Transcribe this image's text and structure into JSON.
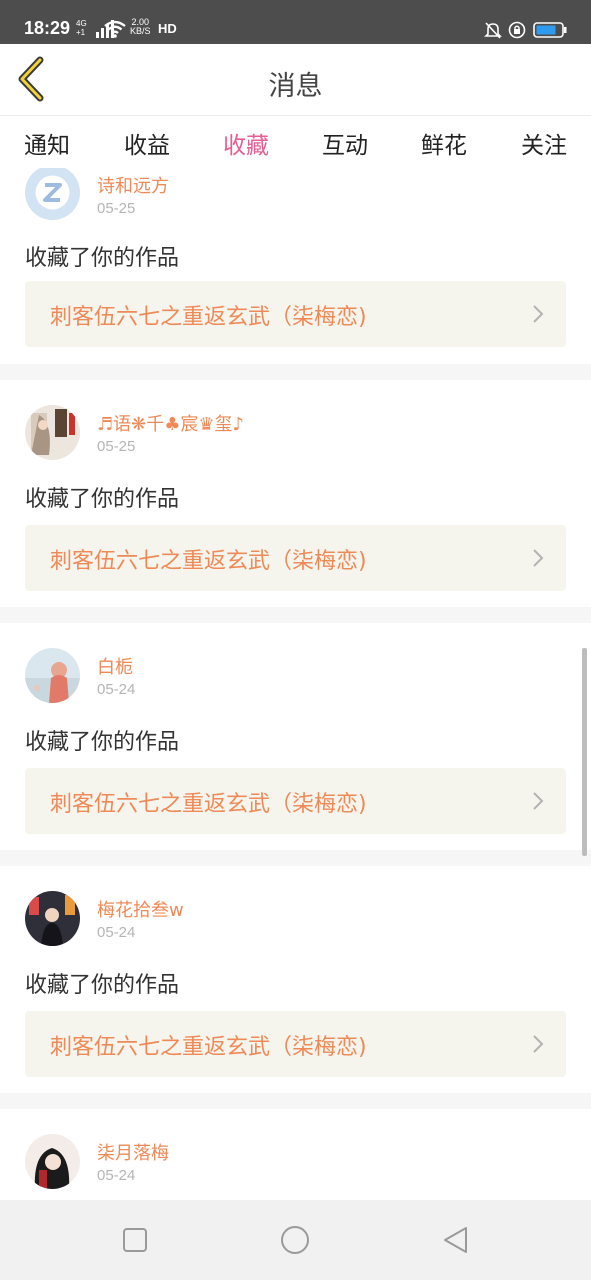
{
  "status": {
    "time": "18:29",
    "net_type": "4G",
    "net_sub": "+1",
    "speed_value": "2.00",
    "speed_unit": "KB/S",
    "hd": "HD"
  },
  "header": {
    "title": "消息",
    "back_icon": "chevron-left-icon"
  },
  "tabs": [
    {
      "label": "通知",
      "active": false
    },
    {
      "label": "收益",
      "active": false
    },
    {
      "label": "收藏",
      "active": true
    },
    {
      "label": "互动",
      "active": false
    },
    {
      "label": "鲜花",
      "active": false
    },
    {
      "label": "关注",
      "active": false
    }
  ],
  "items": [
    {
      "user": "诗和远方",
      "date": "05-25",
      "action": "收藏了你的作品",
      "work": "刺客伍六七之重返玄武（柒梅恋)"
    },
    {
      "user": "♬语❋千♣宸♛玺♪",
      "date": "05-25",
      "action": "收藏了你的作品",
      "work": "刺客伍六七之重返玄武（柒梅恋)"
    },
    {
      "user": "白栀",
      "date": "05-24",
      "action": "收藏了你的作品",
      "work": "刺客伍六七之重返玄武（柒梅恋)"
    },
    {
      "user": "梅花拾叁w",
      "date": "05-24",
      "action": "收藏了你的作品",
      "work": "刺客伍六七之重返玄武（柒梅恋)"
    },
    {
      "user": "柒月落梅",
      "date": "05-24",
      "action": "",
      "work": ""
    }
  ],
  "colors": {
    "accent": "#e75e94",
    "username": "#ef8a57",
    "status_bar": "#4d4d4d",
    "work_bg": "#f5f5ee"
  },
  "nav": {
    "recent": "square-icon",
    "home": "circle-icon",
    "back": "triangle-back-icon"
  }
}
